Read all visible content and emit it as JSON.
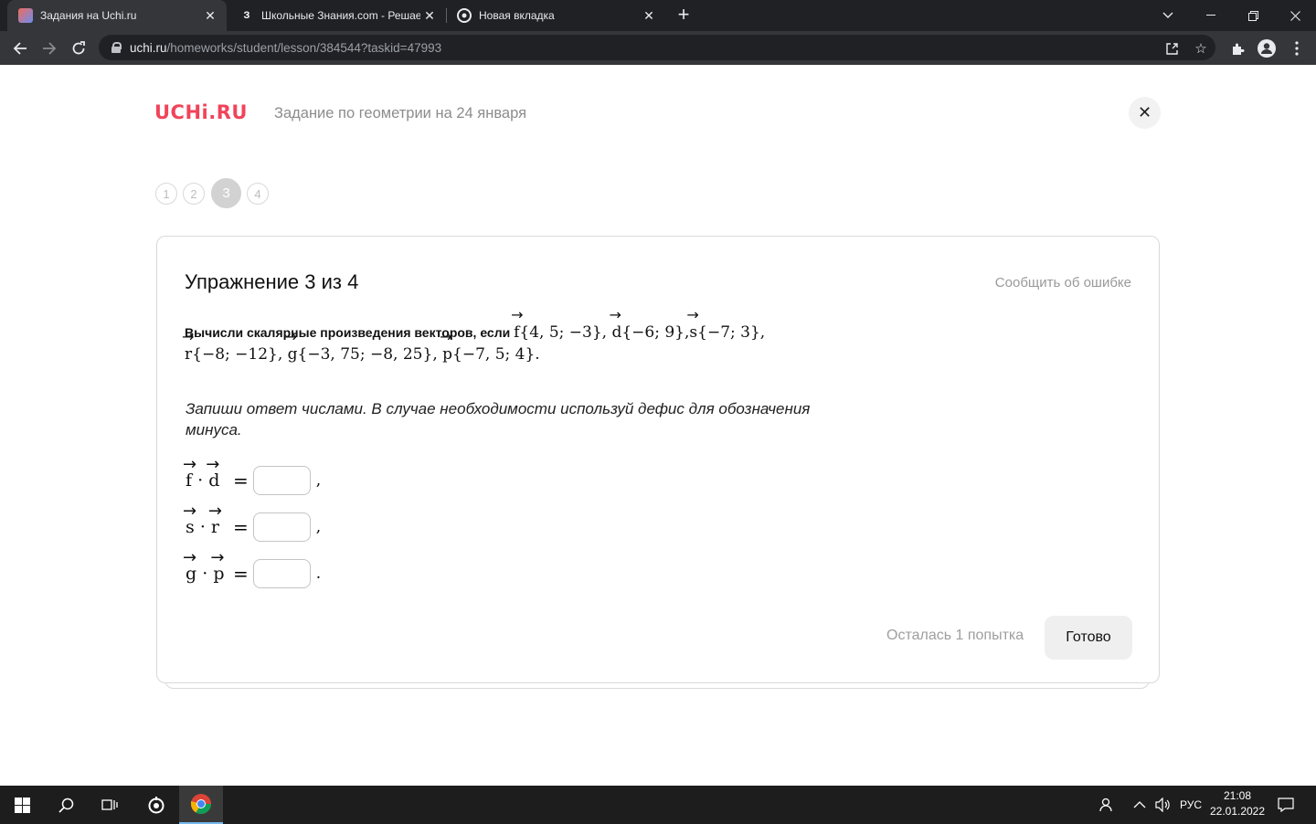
{
  "browser": {
    "tabs": [
      {
        "title": "Задания на Uchi.ru",
        "favicon": "uchi-favicon"
      },
      {
        "title": "Школьные Знания.com - Решае",
        "favicon": "znanija-favicon",
        "favicon_char": "З"
      },
      {
        "title": "Новая вкладка",
        "favicon": "chrome-favicon"
      }
    ],
    "url_host": "uchi.ru",
    "url_path": "/homeworks/student/lesson/384544?taskid=47993"
  },
  "header": {
    "logo": "UCHi.RU",
    "title": "Задание по геометрии на 24 января"
  },
  "steps": [
    "1",
    "2",
    "3",
    "4"
  ],
  "active_step": "3",
  "exercise": {
    "title": "Упражнение 3 из 4",
    "report": "Сообщить об ошибке",
    "lead": "Вычисли скалярные произведения векторов, если",
    "vectors": [
      {
        "name": "f",
        "coords": "{4, 5; −3}"
      },
      {
        "name": "d",
        "coords": "{−6; 9}"
      },
      {
        "name": "s",
        "coords": "{−7; 3}"
      },
      {
        "name": "r",
        "coords": "{−8; −12}"
      },
      {
        "name": "g",
        "coords": "{−3, 75; −8, 25}"
      },
      {
        "name": "p",
        "coords": "{−7, 5; 4}"
      }
    ],
    "instruction": "Запиши ответ числами. В случае необходимости используй дефис для обозначения минуса.",
    "equations": [
      {
        "a": "f",
        "b": "d",
        "dot": "·",
        "equals": "=",
        "value": "",
        "punct": ","
      },
      {
        "a": "s",
        "b": "r",
        "dot": "·",
        "equals": "=",
        "value": "",
        "punct": ","
      },
      {
        "a": "g",
        "b": "p",
        "dot": "·",
        "equals": "=",
        "value": "",
        "punct": "."
      }
    ],
    "attempts": "Осталась 1 попытка",
    "submit": "Готово"
  },
  "taskbar": {
    "lang": "РУС",
    "time": "21:08",
    "date": "22.01.2022"
  },
  "colors": {
    "brand": "#f0445a",
    "tab_strip": "#202124",
    "toolbar": "#35363a",
    "taskbar": "#1d1d1d"
  }
}
